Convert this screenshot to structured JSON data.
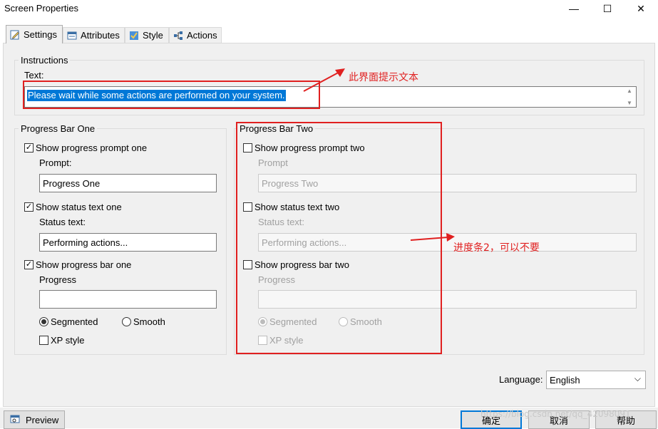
{
  "window": {
    "title": "Screen Properties",
    "min_glyph": "—",
    "max_glyph": "☐",
    "close_glyph": "✕"
  },
  "tabs": [
    {
      "label": "Settings",
      "icon": "pencil-icon"
    },
    {
      "label": "Attributes",
      "icon": "table-icon"
    },
    {
      "label": "Style",
      "icon": "style-icon"
    },
    {
      "label": "Actions",
      "icon": "actions-icon"
    }
  ],
  "instructions": {
    "group_label": "Instructions",
    "text_label": "Text:",
    "text_value": "Please wait while some actions are performed on your system.",
    "up_glyph": "▲",
    "down_glyph": "▼"
  },
  "bar_one": {
    "group_label": "Progress Bar One",
    "show_prompt_label": "Show progress prompt one",
    "show_prompt_checked": true,
    "prompt_label": "Prompt:",
    "prompt_value": "Progress One",
    "show_status_label": "Show status text one",
    "show_status_checked": true,
    "status_label": "Status text:",
    "status_value": "Performing actions...",
    "show_bar_label": "Show progress bar one",
    "show_bar_checked": true,
    "progress_label": "Progress",
    "progress_value": "",
    "segmented_label": "Segmented",
    "smooth_label": "Smooth",
    "selected": "Segmented",
    "xp_label": "XP style",
    "xp_checked": false
  },
  "bar_two": {
    "group_label": "Progress Bar Two",
    "show_prompt_label": "Show progress prompt two",
    "show_prompt_checked": false,
    "prompt_label": "Prompt",
    "prompt_value": "Progress Two",
    "show_status_label": "Show status text two",
    "show_status_checked": false,
    "status_label": "Status text:",
    "status_value": "Performing actions...",
    "show_bar_label": "Show progress bar two",
    "show_bar_checked": false,
    "progress_label": "Progress",
    "progress_value": "",
    "segmented_label": "Segmented",
    "smooth_label": "Smooth",
    "selected": "Segmented",
    "xp_label": "XP style",
    "xp_checked": false
  },
  "annotations": {
    "instructions_note": "此界面提示文本",
    "bar_two_note": "进度条2，可以不要"
  },
  "language": {
    "label": "Language:",
    "value": "English",
    "arrow": "⌵"
  },
  "footer": {
    "preview_label": "Preview",
    "ok_label": "确定",
    "cancel_label": "取消",
    "help_label": "帮助",
    "watermark": "https://blog.csdn.net/qq_42098091"
  },
  "colors": {
    "selection": "#0078d7",
    "annotation": "#e02020",
    "panel": "#f0f0f0"
  },
  "check_glyph": "✓"
}
